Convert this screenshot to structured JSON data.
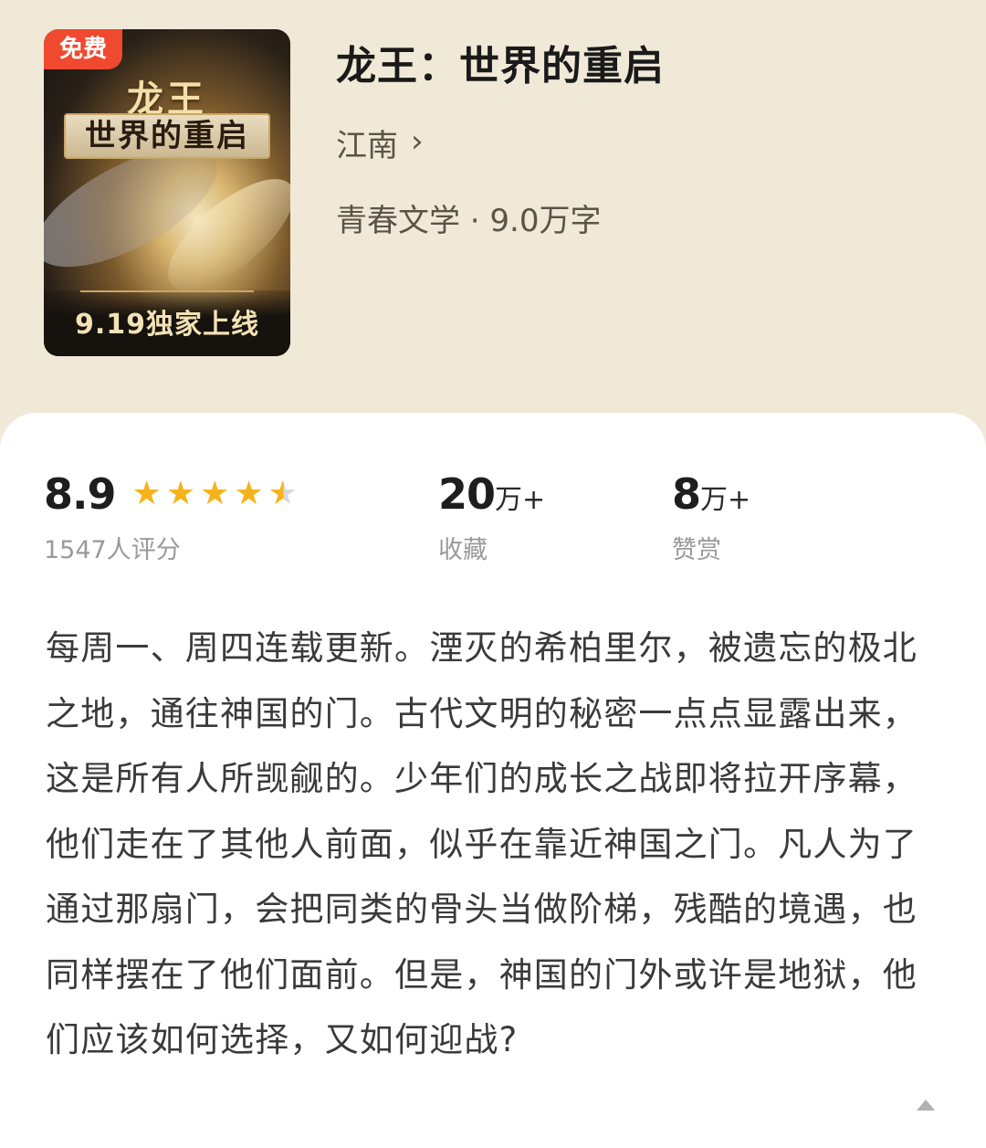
{
  "cover": {
    "free_badge": "免费",
    "title_line1": "龙王",
    "title_line2": "世界的重启",
    "release_banner": "9.19独家上线"
  },
  "book": {
    "title": "龙王：世界的重启",
    "author": "江南",
    "author_chevron": "›",
    "meta": "青春文学 · 9.0万字"
  },
  "stats": {
    "rating": {
      "score": "8.9",
      "stars_value": 4.5,
      "stars_max": 5,
      "label": "1547人评分"
    },
    "favorites": {
      "number": "20",
      "unit": "万+",
      "label": "收藏"
    },
    "rewards": {
      "number": "8",
      "unit": "万+",
      "label": "赞赏"
    }
  },
  "description": "每周一、周四连载更新。湮灭的希柏里尔，被遗忘的极北之地，通往神国的门。古代文明的秘密一点点显露出来，这是所有人所觊觎的。少年们的成长之战即将拉开序幕，他们走在了其他人前面，似乎在靠近神国之门。凡人为了通过那扇门，会把同类的骨头当做阶梯，残酷的境遇，也同样摆在了他们面前。但是，神国的门外或许是地狱，他们应该如何选择，又如何迎战?",
  "icons": {
    "star": "star-icon",
    "collapse": "triangle-up-icon",
    "author_arrow": "chevron-right-icon"
  },
  "colors": {
    "header_bg": "#f0e9d7",
    "star": "#f5b31b",
    "free_badge": "#ef4a2f"
  }
}
